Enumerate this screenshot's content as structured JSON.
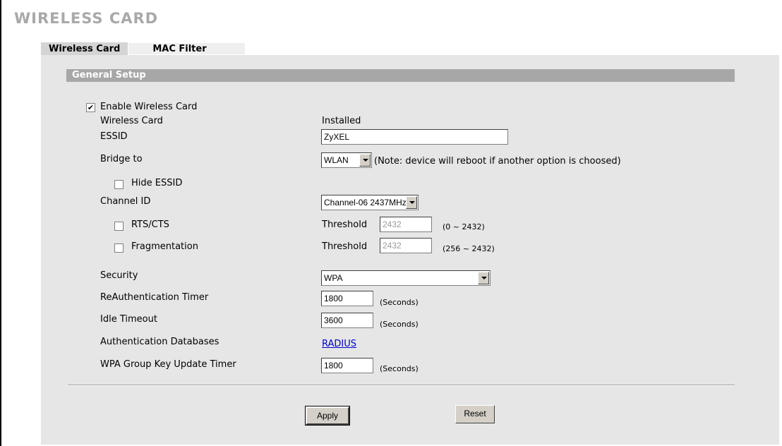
{
  "page": {
    "title": "WIRELESS CARD"
  },
  "tabs": [
    {
      "label": "Wireless Card",
      "active": true
    },
    {
      "label": "MAC Filter",
      "active": false
    }
  ],
  "section": {
    "title": "General Setup"
  },
  "form": {
    "enable_wireless_card": {
      "label": "Enable Wireless Card",
      "checked": true,
      "mark": "✔"
    },
    "wireless_card": {
      "label": "Wireless Card",
      "value": "Installed"
    },
    "essid": {
      "label": "ESSID",
      "value": "ZyXEL"
    },
    "bridge_to": {
      "label": "Bridge to",
      "value": "WLAN",
      "note": "(Note: device will reboot if another option is choosed)"
    },
    "hide_essid": {
      "label": "Hide ESSID",
      "checked": false
    },
    "channel_id": {
      "label": "Channel ID",
      "value": "Channel-06 2437MHz"
    },
    "rts_cts": {
      "label": "RTS/CTS",
      "checked": false,
      "threshold_label": "Threshold",
      "threshold_value": "2432",
      "range": "(0 ~ 2432)"
    },
    "fragmentation": {
      "label": "Fragmentation",
      "checked": false,
      "threshold_label": "Threshold",
      "threshold_value": "2432",
      "range": "(256 ~ 2432)"
    },
    "security": {
      "label": "Security",
      "value": "WPA"
    },
    "reauth_timer": {
      "label": "ReAuthentication Timer",
      "value": "1800",
      "unit": "(Seconds)"
    },
    "idle_timeout": {
      "label": "Idle Timeout",
      "value": "3600",
      "unit": "(Seconds)"
    },
    "auth_databases": {
      "label": "Authentication Databases",
      "link": "RADIUS"
    },
    "wpa_group_key": {
      "label": "WPA Group Key Update Timer",
      "value": "1800",
      "unit": "(Seconds)"
    }
  },
  "buttons": {
    "apply": "Apply",
    "reset": "Reset"
  },
  "icons": {
    "dropdown": "chevron-down-icon",
    "check": "checkmark-icon"
  }
}
